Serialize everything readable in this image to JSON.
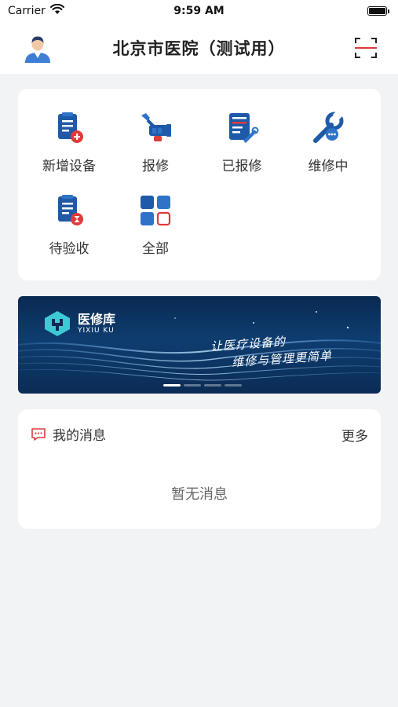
{
  "status_bar": {
    "carrier": "Carrier",
    "time": "9:59 AM"
  },
  "header": {
    "title": "北京市医院（测试用）"
  },
  "actions": [
    {
      "label": "新增设备",
      "icon": "add-device-icon"
    },
    {
      "label": "报修",
      "icon": "repair-request-icon"
    },
    {
      "label": "已报修",
      "icon": "reported-icon"
    },
    {
      "label": "维修中",
      "icon": "in-repair-icon"
    },
    {
      "label": "待验收",
      "icon": "pending-acceptance-icon"
    },
    {
      "label": "全部",
      "icon": "all-grid-icon"
    }
  ],
  "banner": {
    "brand": "医修库",
    "brand_sub": "YIXIU KU",
    "slogan_line1": "让医疗设备的",
    "slogan_line2": "维修与管理更简单"
  },
  "messages": {
    "title": "我的消息",
    "more": "更多",
    "empty": "暂无消息"
  },
  "colors": {
    "primary_blue": "#1e5aa8",
    "accent_red": "#e03a3a",
    "background": "#f2f3f5"
  }
}
